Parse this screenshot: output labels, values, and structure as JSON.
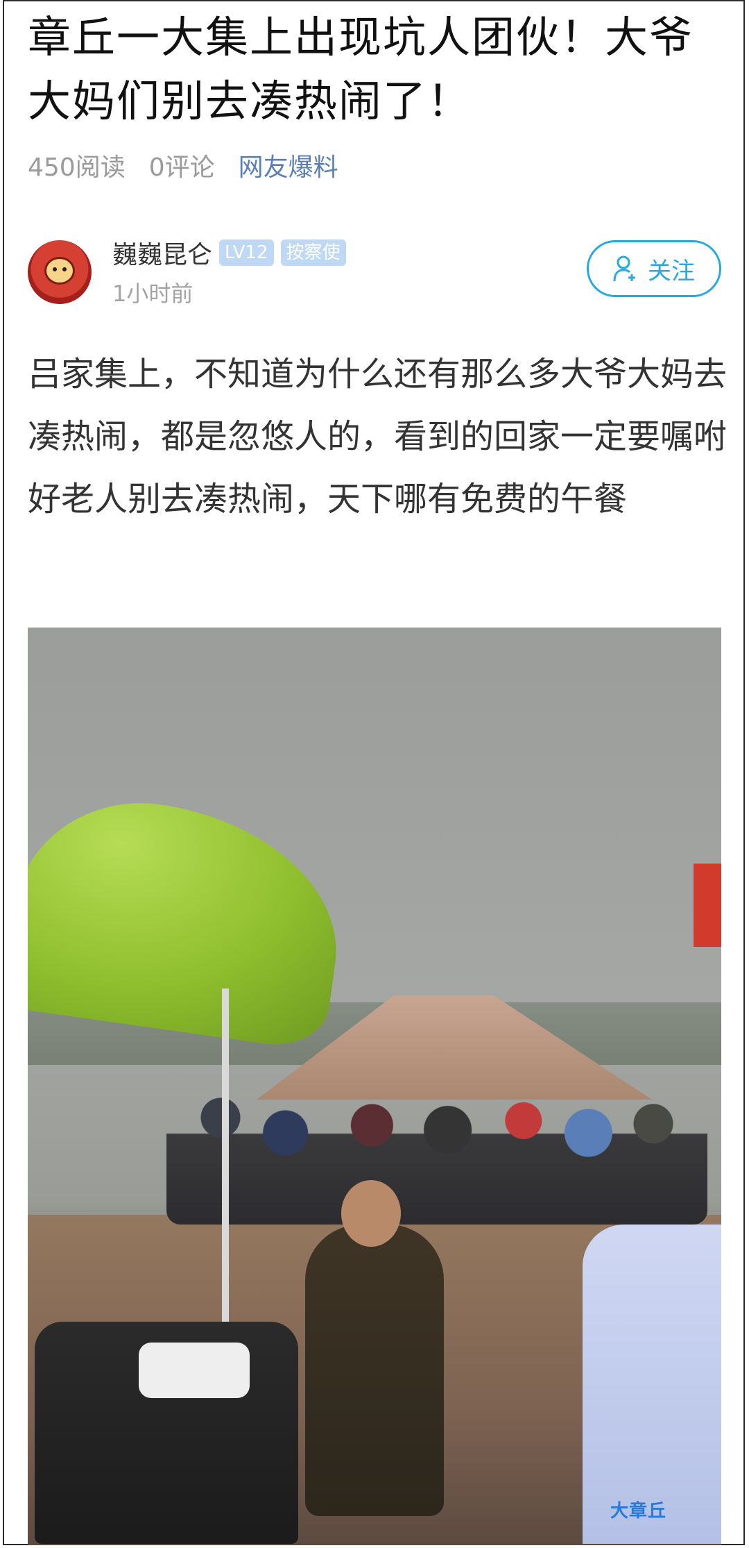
{
  "post": {
    "title": "章丘一大集上出现坑人团伙！大爷大妈们别去凑热闹了！",
    "reads": "450阅读",
    "comments": "0评论",
    "source": "网友爆料"
  },
  "author": {
    "name": "巍巍昆仑",
    "level_badge": "LV12",
    "role_badge": "按察使",
    "time": "1小时前"
  },
  "follow_button": {
    "label": "关注"
  },
  "content": {
    "text": "吕家集上，不知道为什么还有那么多大爷大妈去凑热闹，都是忽悠人的，看到的回家一定要嘱咐好老人别去凑热闹，天下哪有免费的午餐"
  },
  "image": {
    "watermark": "大章丘"
  },
  "icons": {
    "follow": "user-plus-icon"
  },
  "colors": {
    "accent": "#26a9e0",
    "source_link": "#5b7fb3",
    "meta_gray": "#9a9a9a",
    "badge_bg": "#bfd8f4"
  }
}
